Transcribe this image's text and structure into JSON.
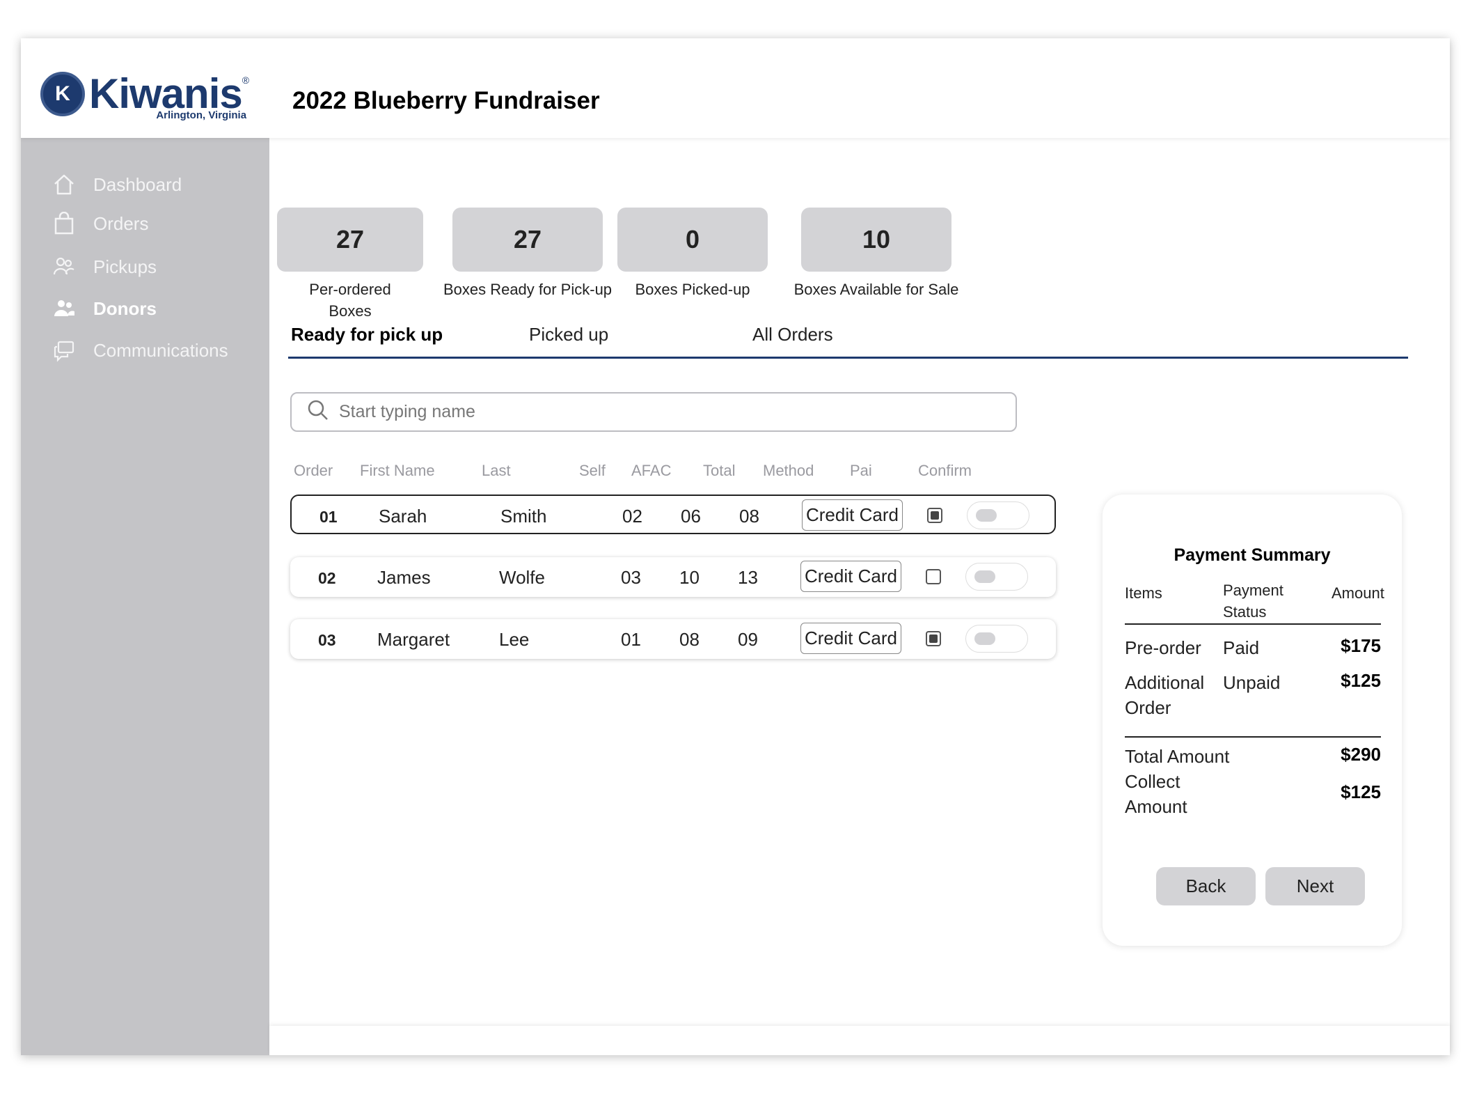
{
  "header": {
    "logo_word": "Kiwanis",
    "logo_reg": "®",
    "logo_sub": "Arlington, Virginia",
    "logo_seal_letter": "K",
    "title": "2022 Blueberry Fundraiser"
  },
  "sidebar": {
    "items": [
      {
        "label": "Dashboard",
        "icon": "home-icon"
      },
      {
        "label": "Orders",
        "icon": "shopping-bag-icon"
      },
      {
        "label": "Pickups",
        "icon": "people-icon"
      },
      {
        "label": "Donors",
        "icon": "users-icon",
        "active": true
      },
      {
        "label": "Communications",
        "icon": "chat-icon"
      }
    ]
  },
  "stats": [
    {
      "value": "27",
      "label_line1": "Per-ordered",
      "label_line2": "Boxes"
    },
    {
      "value": "27",
      "label_line1": "Boxes Ready for Pick-up",
      "label_line2": ""
    },
    {
      "value": "0",
      "label_line1": "Boxes Picked-up",
      "label_line2": ""
    },
    {
      "value": "10",
      "label_line1": "Boxes Available for Sale",
      "label_line2": ""
    }
  ],
  "tabs": [
    {
      "label": "Ready for pick up",
      "active": true
    },
    {
      "label": "Picked up"
    },
    {
      "label": "All Orders"
    }
  ],
  "search": {
    "placeholder": "Start typing name"
  },
  "table": {
    "headers": [
      "Order",
      "First Name",
      "Last",
      "Self",
      "AFAC",
      "Total",
      "Method",
      "Pai",
      "Confirm"
    ],
    "rows": [
      {
        "order": "01",
        "first": "Sarah",
        "last": "Smith",
        "self": "02",
        "afac": "06",
        "total": "08",
        "method": "Credit Card",
        "paid": true,
        "selected": true
      },
      {
        "order": "02",
        "first": "James",
        "last": "Wolfe",
        "self": "03",
        "afac": "10",
        "total": "13",
        "method": "Credit Card",
        "paid": false,
        "selected": false
      },
      {
        "order": "03",
        "first": "Margaret",
        "last": "Lee",
        "self": "01",
        "afac": "08",
        "total": "09",
        "method": "Credit Card",
        "paid": true,
        "selected": false
      }
    ]
  },
  "summary": {
    "title": "Payment Summary",
    "col_items": "Items",
    "col_status_1": "Payment",
    "col_status_2": "Status",
    "col_amount": "Amount",
    "rows": [
      {
        "item_1": "Pre-order",
        "item_2": "",
        "status": "Paid",
        "amount": "$175"
      },
      {
        "item_1": "Additional",
        "item_2": "Order",
        "status": "Unpaid",
        "amount": "$125"
      }
    ],
    "total_label": "Total Amount",
    "total_amount": "$290",
    "collect_label_1": "Collect",
    "collect_label_2": "Amount",
    "collect_amount": "$125",
    "back_label": "Back",
    "next_label": "Next"
  },
  "colors": {
    "brand_navy": "#1d3a6e",
    "sidebar_bg": "#c4c4c7",
    "stat_box_bg": "#d3d3d6"
  }
}
